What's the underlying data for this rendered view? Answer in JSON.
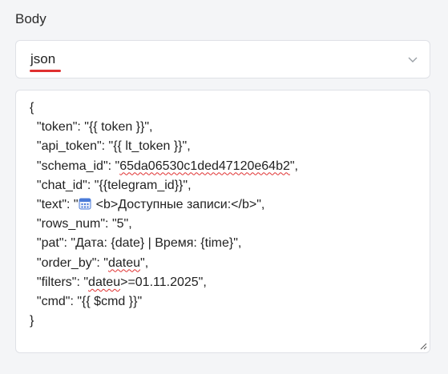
{
  "section": {
    "label": "Body"
  },
  "format_select": {
    "value": "json"
  },
  "body_editor": {
    "lines": [
      {
        "pre": "{"
      },
      {
        "pre": "  \"token\": \"{{ token }}\","
      },
      {
        "pre": "  \"api_token\": \"{{ lt_token }}\","
      },
      {
        "pre": "  \"schema_id\": \"",
        "flag": "65da06530c1ded47120e64b2",
        "post": "\","
      },
      {
        "pre": "  \"chat_id\": \"{{telegram_id}}\","
      },
      {
        "pre": "  \"text\": \"",
        "icon": "calendar-icon",
        "post": "<b>Доступные записи:</b>\","
      },
      {
        "pre": "  \"rows_num\": \"5\","
      },
      {
        "pre": "  \"pat\": \"Дата: {date} | Время: {time}\","
      },
      {
        "pre": "  \"order_by\": \"",
        "flag": "dateu",
        "post": "\","
      },
      {
        "pre": "  \"filters\": \"",
        "flag": "dateu",
        "post": ">=01.11.2025\","
      },
      {
        "pre": "  \"cmd\": \"{{ $cmd }}\""
      },
      {
        "pre": "}"
      }
    ]
  },
  "colors": {
    "spellcheck": "#e03030",
    "calendar": "#4a7bd8"
  },
  "icons": {
    "select_arrow": "chevron-down-icon",
    "resize": "resize-handle-icon"
  }
}
